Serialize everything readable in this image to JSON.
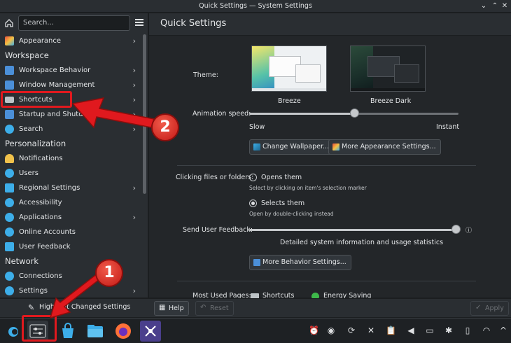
{
  "window": {
    "title": "Quick Settings — System Settings"
  },
  "sidebar": {
    "search_placeholder": "Search...",
    "sections": {
      "workspace": "Workspace",
      "personalization": "Personalization",
      "network": "Network"
    },
    "items": [
      {
        "label": "Appearance",
        "icon": "appearance-icon",
        "color": "#5a9ae0"
      },
      {
        "label": "Workspace Behavior",
        "icon": "workspace-behavior-icon",
        "color": "#4b8fd8"
      },
      {
        "label": "Window Management",
        "icon": "window-management-icon",
        "color": "#4b8fd8"
      },
      {
        "label": "Shortcuts",
        "icon": "keyboard-icon",
        "color": "#bdc3c7"
      },
      {
        "label": "Startup and Shutdown",
        "icon": "startup-icon",
        "color": "#4b8fd8"
      },
      {
        "label": "Search",
        "icon": "search-icon",
        "color": "#3daee9"
      },
      {
        "label": "Notifications",
        "icon": "bell-icon",
        "color": "#f0c14b"
      },
      {
        "label": "Users",
        "icon": "users-icon",
        "color": "#3daee9"
      },
      {
        "label": "Regional Settings",
        "icon": "flag-icon",
        "color": "#3daee9"
      },
      {
        "label": "Accessibility",
        "icon": "accessibility-icon",
        "color": "#3daee9"
      },
      {
        "label": "Applications",
        "icon": "applications-icon",
        "color": "#3daee9"
      },
      {
        "label": "Online Accounts",
        "icon": "online-accounts-icon",
        "color": "#3daee9"
      },
      {
        "label": "User Feedback",
        "icon": "user-feedback-icon",
        "color": "#3daee9"
      },
      {
        "label": "Connections",
        "icon": "connections-icon",
        "color": "#3daee9"
      },
      {
        "label": "Settings",
        "icon": "network-settings-icon",
        "color": "#3daee9"
      }
    ],
    "highlight_label": "Highlight Changed Settings"
  },
  "main": {
    "title": "Quick Settings",
    "theme_label": "Theme:",
    "themes": [
      {
        "name": "Breeze"
      },
      {
        "name": "Breeze Dark"
      }
    ],
    "animation_label": "Animation speed:",
    "animation_slow": "Slow",
    "animation_instant": "Instant",
    "animation_value": 0.5,
    "change_wallpaper": "Change Wallpaper...",
    "more_appearance": "More Appearance Settings...",
    "clicking_label": "Clicking files or folders:",
    "opens_them": "Opens them",
    "opens_hint": "Select by clicking on item's selection marker",
    "selects_them": "Selects them",
    "selects_hint": "Open by double-clicking instead",
    "feedback_label": "Send User Feedback:",
    "feedback_value": 1.0,
    "feedback_desc": "Detailed system information and usage statistics",
    "more_behavior": "More Behavior Settings...",
    "most_used_label": "Most Used Pages:",
    "most_used": [
      "Shortcuts",
      "Energy Saving"
    ]
  },
  "bottom": {
    "help": "Help",
    "reset": "Reset",
    "apply": "Apply"
  },
  "annotations": {
    "one": "1",
    "two": "2",
    "color": "#e0191e"
  }
}
